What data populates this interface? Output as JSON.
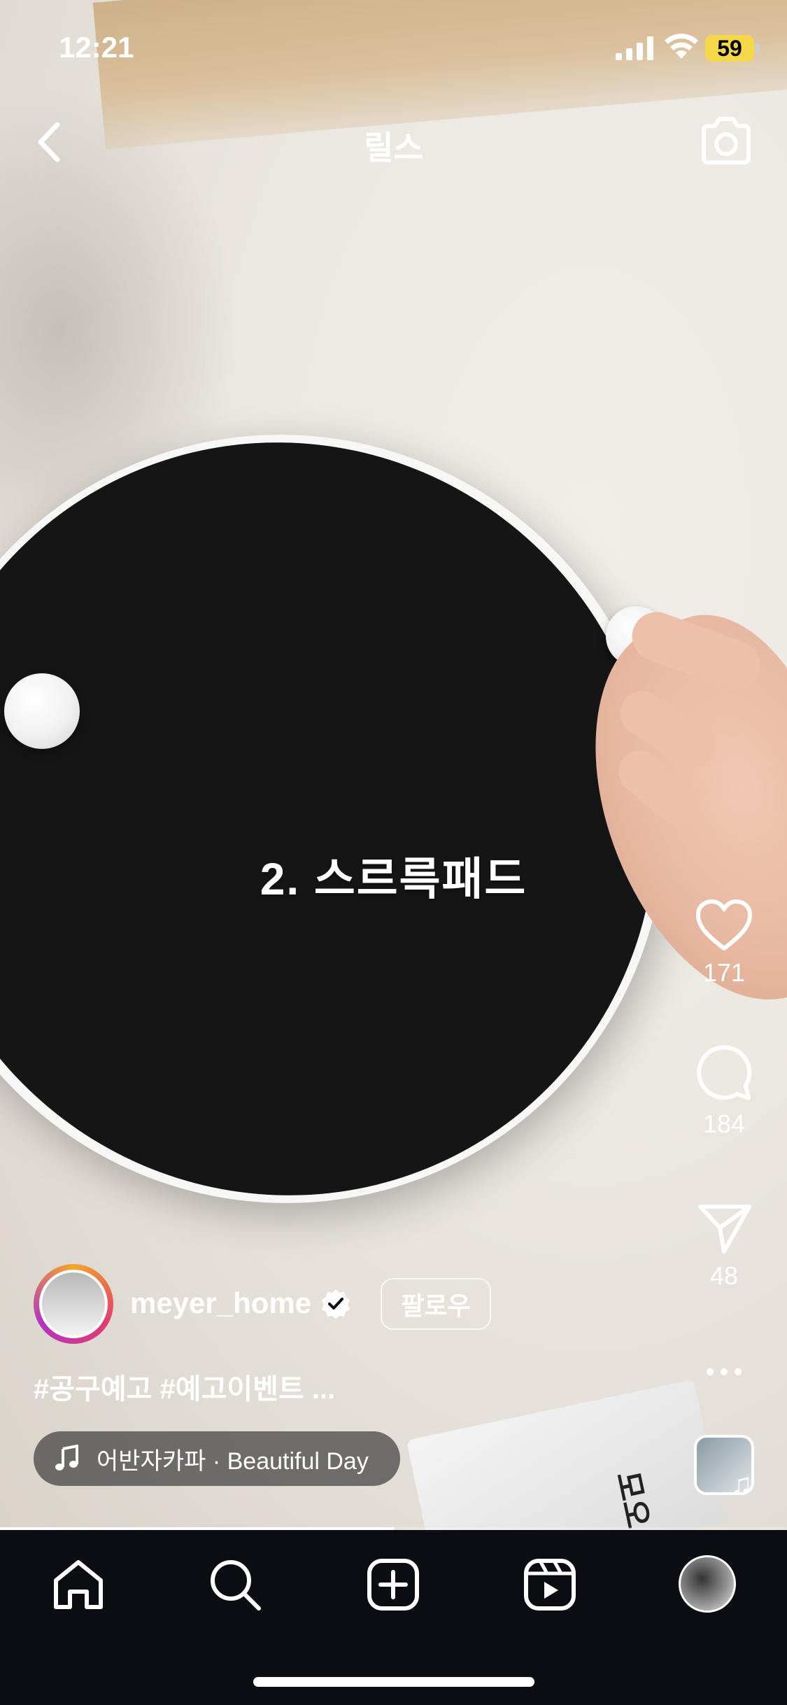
{
  "status_bar": {
    "time": "12:21",
    "battery": "59",
    "battery_color": "#F4D84A"
  },
  "header": {
    "title": "릴스"
  },
  "video": {
    "overlay_text": "2. 스르륵패드",
    "bag_text": "모오"
  },
  "actions": {
    "likes": "171",
    "comments": "184",
    "shares": "48"
  },
  "post": {
    "username": "meyer_home",
    "follow_label": "팔로우",
    "caption": "#공구예고 #예고이벤트 ...",
    "music": "어반자카파 · Beautiful Day"
  },
  "progress": {
    "fraction": 0.5
  },
  "nav": {
    "items": [
      "home-icon",
      "search-icon",
      "create-icon",
      "reels-icon",
      "profile-avatar"
    ]
  },
  "colors": {
    "nav_bg": "#0B0D12",
    "avatar_ring": [
      "#F4A62A",
      "#E03C6E",
      "#B333C3"
    ]
  }
}
